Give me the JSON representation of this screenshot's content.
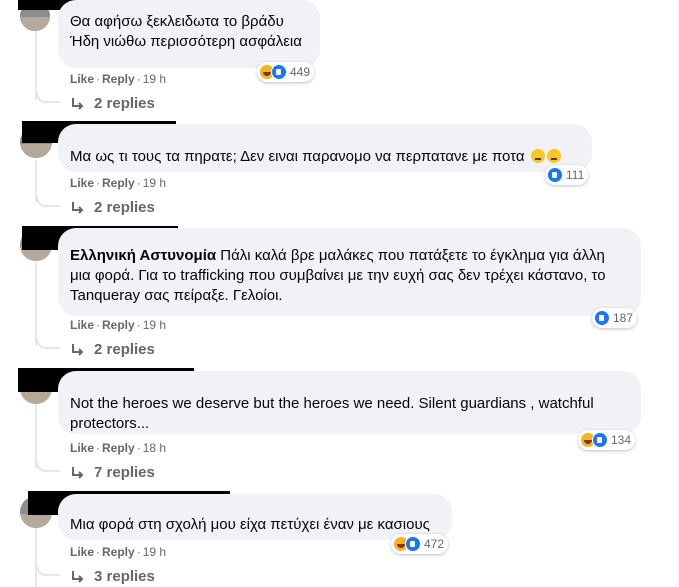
{
  "comments": [
    {
      "author": "",
      "text_lines": [
        "Θα αφήσω ξεκλειδωτα το βράδυ",
        "Ήδη νιώθω περισσότερη ασφάλεια"
      ],
      "reactions": {
        "count": "449",
        "types": [
          "haha-icon",
          "like-icon"
        ]
      },
      "like": "Like",
      "reply": "Reply",
      "time": "19 h",
      "replies": "2 replies"
    },
    {
      "author": "",
      "text": "Μα ως τι τους τα πηρατε; Δεν ειναι παρανομο να περπατανε με ποτα",
      "trailing_emoji": [
        "thinking-face-icon",
        "grimacing-face-icon"
      ],
      "reactions": {
        "count": "111",
        "types": [
          "like-icon"
        ]
      },
      "like": "Like",
      "reply": "Reply",
      "time": "19 h",
      "replies": "2 replies"
    },
    {
      "author": "",
      "mention": "Ελληνική Αστυνομία",
      "text_lines": [
        " Πάλι καλά βρε μαλάκες που πατάξετε το έγκλημα για άλλη",
        "μια φορά. Για το trafficking που συμβαίνει με την ευχή σας δεν τρέχει κάστανο, το",
        "Tanqueray σας πείραξε. Γελοίοι."
      ],
      "reactions": {
        "count": "187",
        "types": [
          "like-icon"
        ]
      },
      "like": "Like",
      "reply": "Reply",
      "time": "19 h",
      "replies": "2 replies"
    },
    {
      "author": "",
      "text_lines": [
        "Not the heroes we deserve but the heroes we need. Silent guardians , watchful",
        "protectors..."
      ],
      "reactions": {
        "count": "134",
        "types": [
          "haha-icon",
          "like-icon"
        ]
      },
      "like": "Like",
      "reply": "Reply",
      "time": "18 h",
      "replies": "7 replies"
    },
    {
      "author": "",
      "text": "Μια φορά στη σχολή μου είχα πετύχει έναν με κασιους",
      "reactions": {
        "count": "472",
        "types": [
          "haha-icon",
          "like-icon"
        ]
      },
      "like": "Like",
      "reply": "Reply",
      "time": "19 h",
      "replies": "3 replies"
    }
  ],
  "colors": {
    "bubble": "#f0f2f5",
    "meta": "#65676b",
    "like_blue": "#1877f2",
    "haha_yellow": "#f7b125"
  }
}
